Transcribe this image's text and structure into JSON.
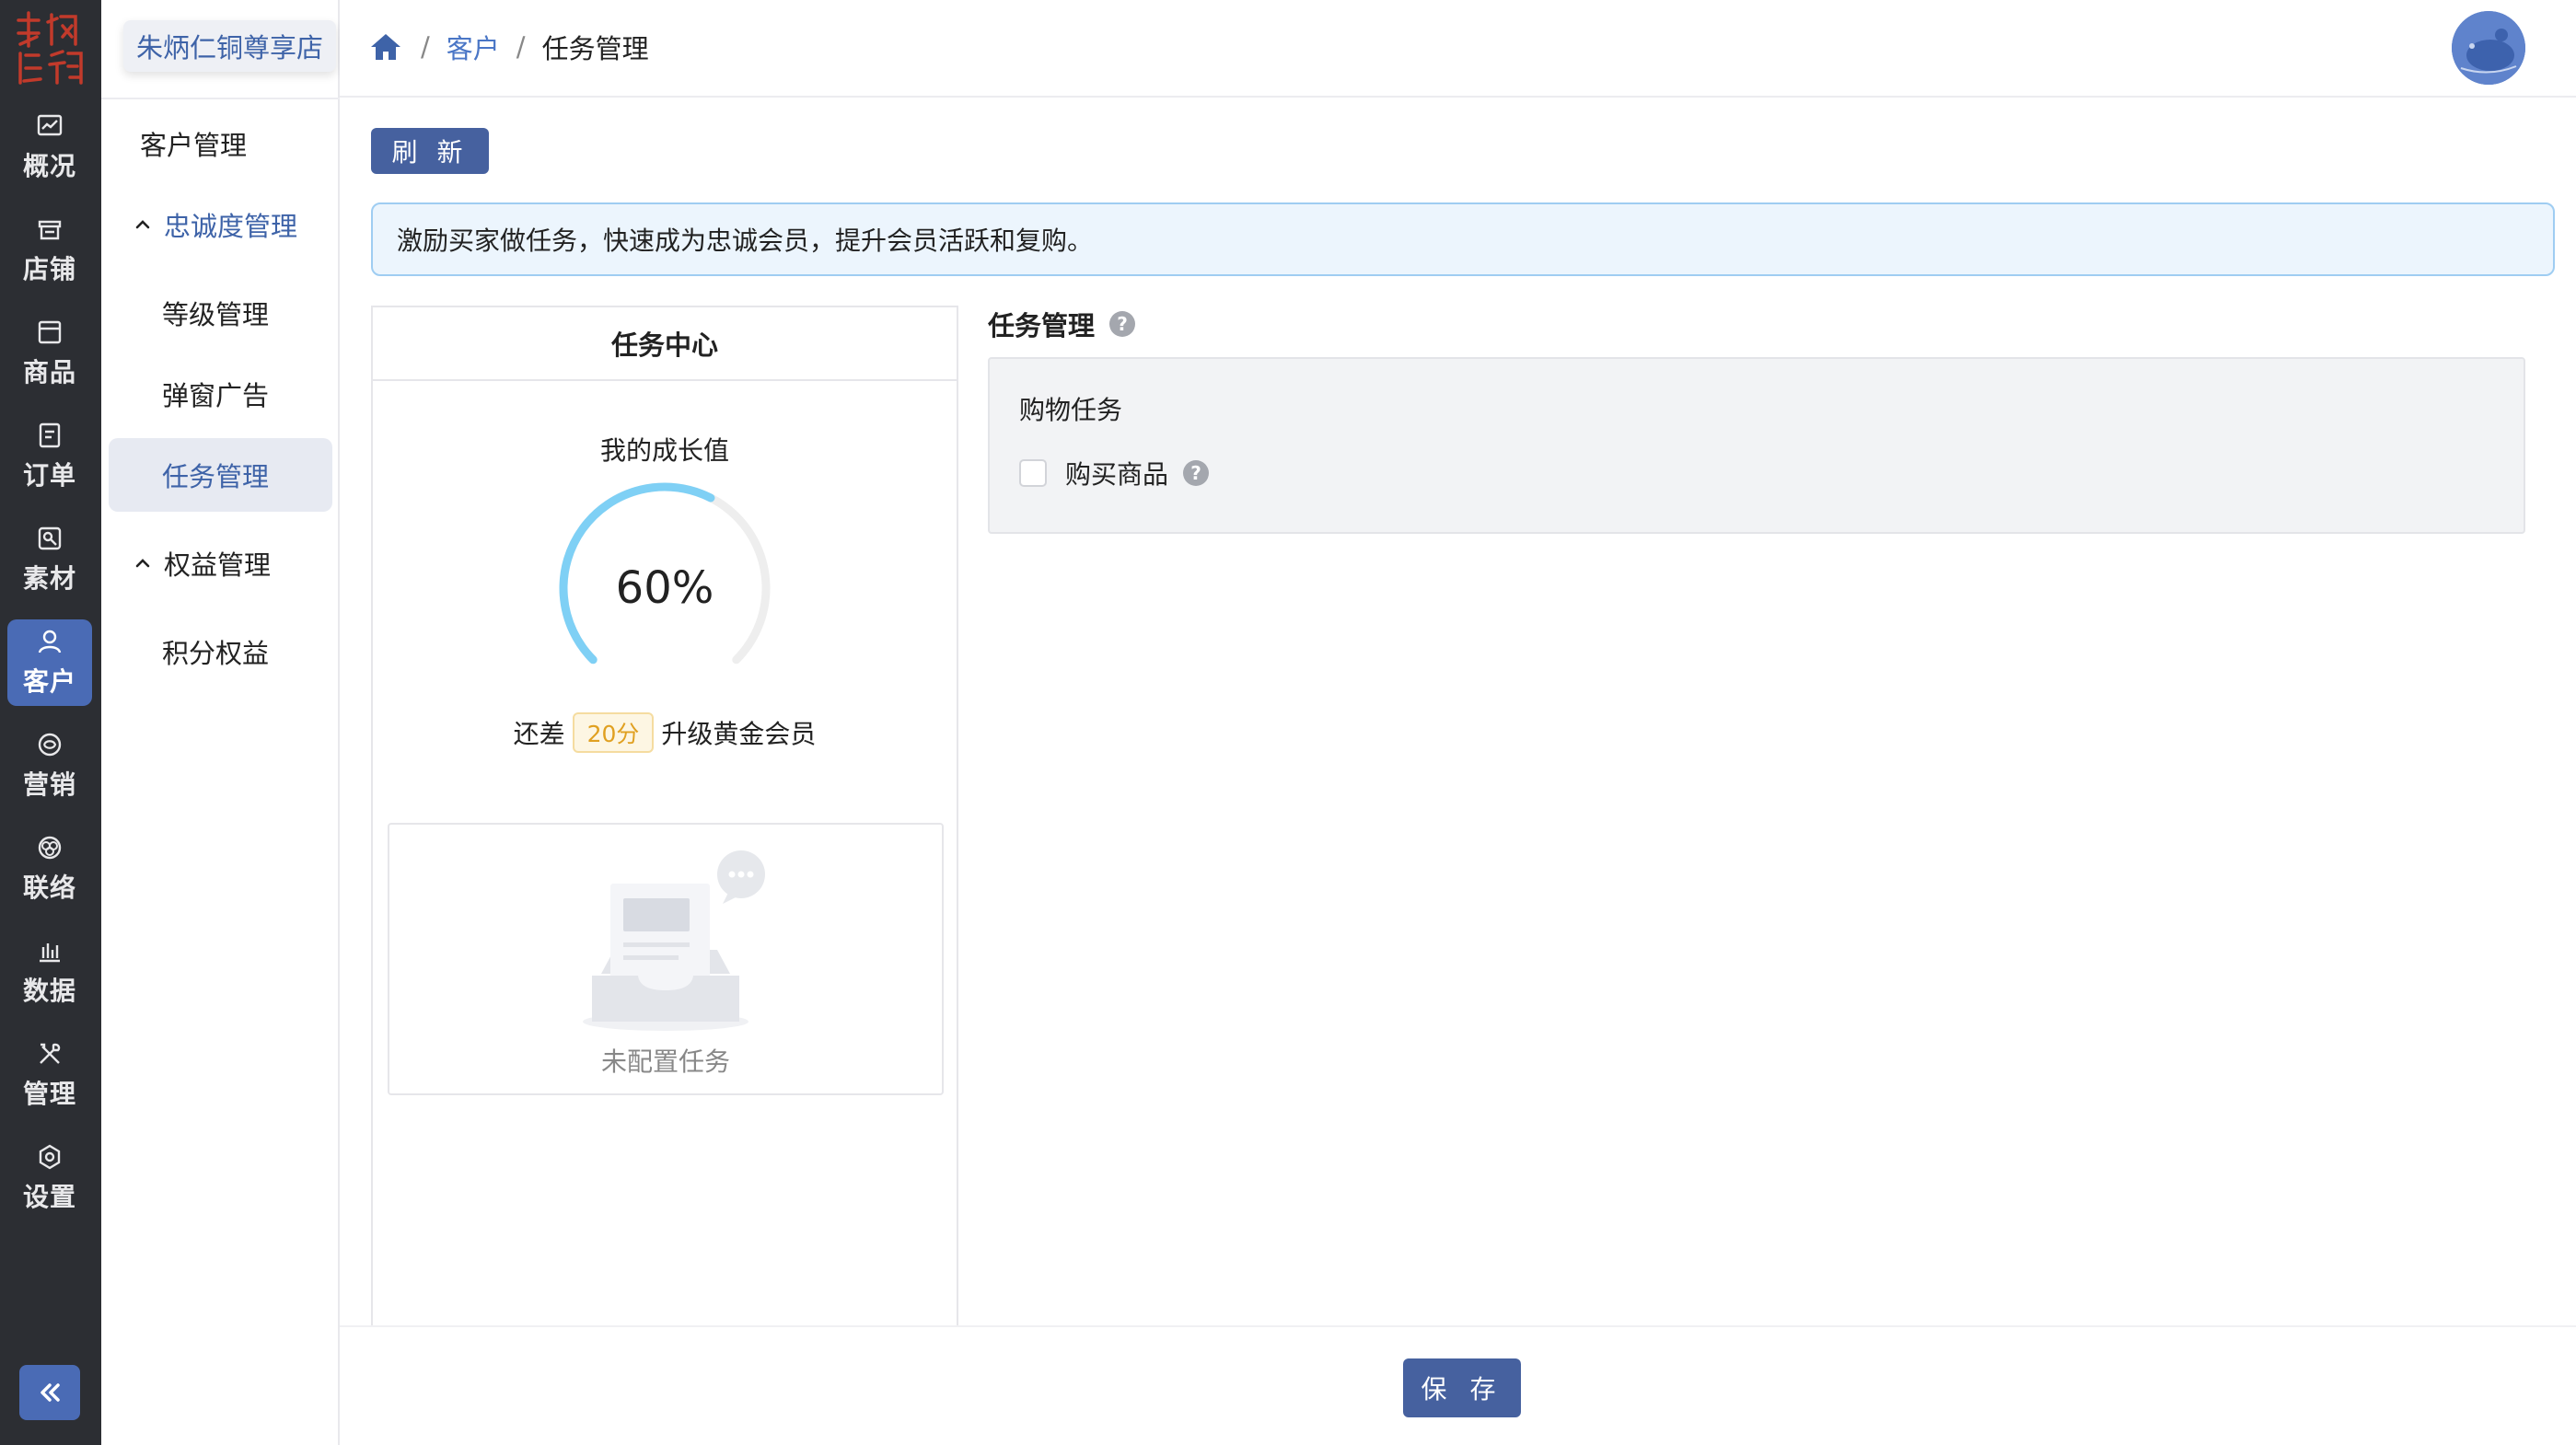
{
  "brand": {
    "logo_text": "朱炳仁铜",
    "accent": "#4a6bb5"
  },
  "rail": {
    "items": [
      {
        "label": "概况",
        "icon": "chart-icon"
      },
      {
        "label": "店铺",
        "icon": "store-icon"
      },
      {
        "label": "商品",
        "icon": "box-icon"
      },
      {
        "label": "订单",
        "icon": "order-icon"
      },
      {
        "label": "素材",
        "icon": "image-icon"
      },
      {
        "label": "客户",
        "icon": "user-icon",
        "active": true
      },
      {
        "label": "营销",
        "icon": "marketing-icon"
      },
      {
        "label": "联络",
        "icon": "contact-icon"
      },
      {
        "label": "数据",
        "icon": "bar-chart-icon"
      },
      {
        "label": "管理",
        "icon": "tools-icon"
      },
      {
        "label": "设置",
        "icon": "settings-icon"
      }
    ],
    "collapse_icon": "double-chevron-left-icon"
  },
  "submenu": {
    "store_name": "朱炳仁铜尊享店",
    "items": [
      {
        "label": "客户管理"
      },
      {
        "label": "忠诚度管理"
      },
      {
        "label": "等级管理"
      },
      {
        "label": "弹窗广告"
      },
      {
        "label": "任务管理"
      },
      {
        "label": "权益管理"
      },
      {
        "label": "积分权益"
      }
    ]
  },
  "header": {
    "breadcrumb": [
      "客户",
      "任务管理"
    ],
    "separator": "/"
  },
  "main": {
    "refresh_label": "刷 新",
    "notice": "激励买家做任务，快速成为忠诚会员，提升会员活跃和复购。",
    "task_center": {
      "title": "任务中心",
      "growth_label": "我的成长值",
      "progress_percent": 60,
      "progress_text": "60%",
      "upgrade_prefix": "还差",
      "points_needed": "20分",
      "upgrade_suffix": "升级黄金会员",
      "empty_text": "未配置任务"
    },
    "task_management": {
      "title": "任务管理",
      "group_title": "购物任务",
      "option_label": "购买商品"
    }
  },
  "footer": {
    "save_label": "保 存"
  }
}
